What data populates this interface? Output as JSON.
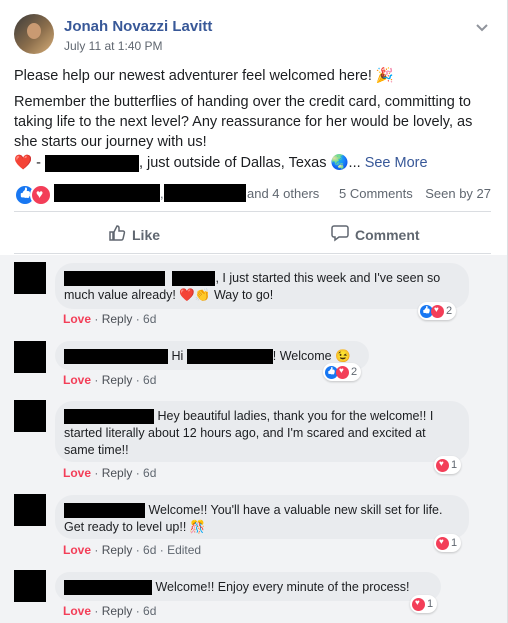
{
  "post": {
    "author": "Jonah Novazzi Lavitt",
    "timestamp": "July 11 at 1:40 PM",
    "line1": "Please help our newest adventurer feel welcomed here! 🎉",
    "line2": "Remember the butterflies of handing over the credit card, committing to taking life to the next level? Any reassurance for her would be lovely, as she starts our journey with us!",
    "line3_prefix": "❤️ -",
    "line3_mid": ", just outside of Dallas, Texas 🌏...",
    "see_more": "See More"
  },
  "reactions": {
    "others": "and 4 others",
    "comments_count": "5 Comments",
    "seen_by": "Seen by 27"
  },
  "actions": {
    "like": "Like",
    "comment": "Comment"
  },
  "comments": [
    {
      "text_after": ", I just started this week and I've seen so much value already! ❤️👏 Way to go!",
      "love": "Love",
      "reply": "Reply",
      "age": "6d",
      "reaction_count": "2"
    },
    {
      "text_hi": "Hi",
      "text_after": "! Welcome 😉",
      "love": "Love",
      "reply": "Reply",
      "age": "6d",
      "reaction_count": "2"
    },
    {
      "text_after": "Hey beautiful ladies, thank you for the welcome!! I started literally about 12 hours ago, and I'm scared and excited at same time!!",
      "love": "Love",
      "reply": "Reply",
      "age": "6d",
      "reaction_count": "1"
    },
    {
      "text_after": "Welcome!! You'll have a valuable new skill set for life. Get ready to level up!! 🎊",
      "love": "Love",
      "reply": "Reply",
      "age": "6d",
      "edited": "Edited",
      "reaction_count": "1"
    },
    {
      "text_after": "Welcome!! Enjoy every minute of the process!",
      "love": "Love",
      "reply": "Reply",
      "age": "6d",
      "reaction_count": "1"
    }
  ],
  "colors": {
    "link": "#385898",
    "love": "#f33e58",
    "like": "#1877f2",
    "bubble": "#e9ebee",
    "comment_bg": "#f2f3f5"
  },
  "icons": {
    "menu": "chevron-down-icon",
    "like": "thumbs-up-icon",
    "comment": "speech-bubble-icon"
  }
}
